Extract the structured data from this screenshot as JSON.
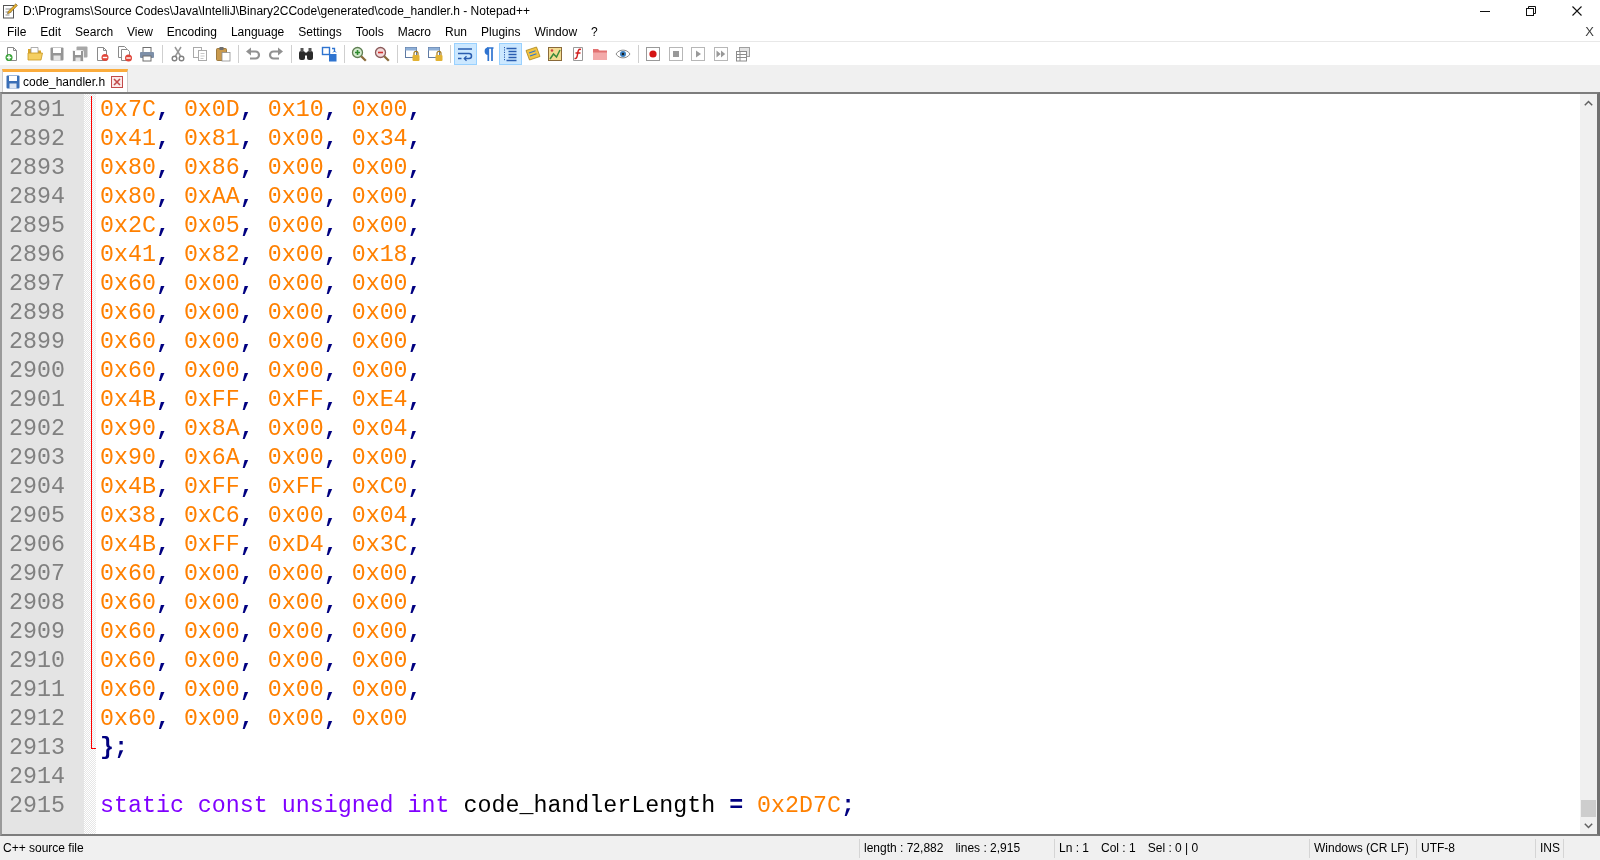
{
  "window": {
    "title": "D:\\Programs\\Source Codes\\Java\\IntelliJ\\Binary2CCode\\generated\\code_handler.h - Notepad++"
  },
  "menu": {
    "items": [
      "File",
      "Edit",
      "Search",
      "View",
      "Encoding",
      "Language",
      "Settings",
      "Tools",
      "Macro",
      "Run",
      "Plugins",
      "Window",
      "?"
    ],
    "close_document": "X"
  },
  "toolbar": {
    "groups": [
      {
        "buttons": [
          {
            "kind": "new",
            "pressed": false,
            "disabled": false
          },
          {
            "kind": "open",
            "pressed": false,
            "disabled": false
          },
          {
            "kind": "save",
            "pressed": false,
            "disabled": true
          },
          {
            "kind": "saveall",
            "pressed": false,
            "disabled": true
          },
          {
            "kind": "close",
            "pressed": false,
            "disabled": false
          },
          {
            "kind": "closeall",
            "pressed": false,
            "disabled": false
          },
          {
            "kind": "print",
            "pressed": false,
            "disabled": false
          }
        ]
      },
      {
        "buttons": [
          {
            "kind": "cut",
            "pressed": false,
            "disabled": true
          },
          {
            "kind": "copy",
            "pressed": false,
            "disabled": true
          },
          {
            "kind": "paste",
            "pressed": false,
            "disabled": false
          }
        ]
      },
      {
        "buttons": [
          {
            "kind": "undo",
            "pressed": false,
            "disabled": true
          },
          {
            "kind": "redo",
            "pressed": false,
            "disabled": true
          }
        ]
      },
      {
        "buttons": [
          {
            "kind": "find",
            "pressed": false,
            "disabled": false
          },
          {
            "kind": "replace",
            "pressed": false,
            "disabled": false
          }
        ]
      },
      {
        "buttons": [
          {
            "kind": "zoomin",
            "pressed": false,
            "disabled": false
          },
          {
            "kind": "zoomout",
            "pressed": false,
            "disabled": false
          }
        ]
      },
      {
        "buttons": [
          {
            "kind": "syncv",
            "pressed": false,
            "disabled": false
          },
          {
            "kind": "synch",
            "pressed": false,
            "disabled": false
          }
        ]
      },
      {
        "buttons": [
          {
            "kind": "wrap",
            "pressed": true,
            "disabled": false
          },
          {
            "kind": "allchars",
            "pressed": false,
            "disabled": false
          },
          {
            "kind": "indent",
            "pressed": true,
            "disabled": false
          },
          {
            "kind": "udl",
            "pressed": false,
            "disabled": false
          },
          {
            "kind": "docmap",
            "pressed": false,
            "disabled": false
          },
          {
            "kind": "funclist",
            "pressed": false,
            "disabled": false
          },
          {
            "kind": "folder",
            "pressed": false,
            "disabled": false
          },
          {
            "kind": "monitor",
            "pressed": false,
            "disabled": false
          }
        ]
      },
      {
        "buttons": [
          {
            "kind": "record",
            "pressed": false,
            "disabled": false
          },
          {
            "kind": "stop",
            "pressed": false,
            "disabled": true
          },
          {
            "kind": "play",
            "pressed": false,
            "disabled": true
          },
          {
            "kind": "playmulti",
            "pressed": false,
            "disabled": true
          },
          {
            "kind": "savemacro",
            "pressed": false,
            "disabled": true
          }
        ]
      }
    ]
  },
  "tabs": [
    {
      "label": "code_handler.h",
      "selected": true,
      "modified": false
    }
  ],
  "editor": {
    "lines": [
      {
        "number": "2891",
        "in_fold": true,
        "fold_end": false,
        "tokens": [
          {
            "kind": "hex",
            "text": "0x7C"
          },
          {
            "kind": "operator",
            "text": ", "
          },
          {
            "kind": "hex",
            "text": "0x0D"
          },
          {
            "kind": "operator",
            "text": ", "
          },
          {
            "kind": "hex",
            "text": "0x10"
          },
          {
            "kind": "operator",
            "text": ", "
          },
          {
            "kind": "hex",
            "text": "0x00"
          },
          {
            "kind": "operator",
            "text": ","
          }
        ]
      },
      {
        "number": "2892",
        "in_fold": true,
        "fold_end": false,
        "tokens": [
          {
            "kind": "hex",
            "text": "0x41"
          },
          {
            "kind": "operator",
            "text": ", "
          },
          {
            "kind": "hex",
            "text": "0x81"
          },
          {
            "kind": "operator",
            "text": ", "
          },
          {
            "kind": "hex",
            "text": "0x00"
          },
          {
            "kind": "operator",
            "text": ", "
          },
          {
            "kind": "hex",
            "text": "0x34"
          },
          {
            "kind": "operator",
            "text": ","
          }
        ]
      },
      {
        "number": "2893",
        "in_fold": true,
        "fold_end": false,
        "tokens": [
          {
            "kind": "hex",
            "text": "0x80"
          },
          {
            "kind": "operator",
            "text": ", "
          },
          {
            "kind": "hex",
            "text": "0x86"
          },
          {
            "kind": "operator",
            "text": ", "
          },
          {
            "kind": "hex",
            "text": "0x00"
          },
          {
            "kind": "operator",
            "text": ", "
          },
          {
            "kind": "hex",
            "text": "0x00"
          },
          {
            "kind": "operator",
            "text": ","
          }
        ]
      },
      {
        "number": "2894",
        "in_fold": true,
        "fold_end": false,
        "tokens": [
          {
            "kind": "hex",
            "text": "0x80"
          },
          {
            "kind": "operator",
            "text": ", "
          },
          {
            "kind": "hex",
            "text": "0xAA"
          },
          {
            "kind": "operator",
            "text": ", "
          },
          {
            "kind": "hex",
            "text": "0x00"
          },
          {
            "kind": "operator",
            "text": ", "
          },
          {
            "kind": "hex",
            "text": "0x00"
          },
          {
            "kind": "operator",
            "text": ","
          }
        ]
      },
      {
        "number": "2895",
        "in_fold": true,
        "fold_end": false,
        "tokens": [
          {
            "kind": "hex",
            "text": "0x2C"
          },
          {
            "kind": "operator",
            "text": ", "
          },
          {
            "kind": "hex",
            "text": "0x05"
          },
          {
            "kind": "operator",
            "text": ", "
          },
          {
            "kind": "hex",
            "text": "0x00"
          },
          {
            "kind": "operator",
            "text": ", "
          },
          {
            "kind": "hex",
            "text": "0x00"
          },
          {
            "kind": "operator",
            "text": ","
          }
        ]
      },
      {
        "number": "2896",
        "in_fold": true,
        "fold_end": false,
        "tokens": [
          {
            "kind": "hex",
            "text": "0x41"
          },
          {
            "kind": "operator",
            "text": ", "
          },
          {
            "kind": "hex",
            "text": "0x82"
          },
          {
            "kind": "operator",
            "text": ", "
          },
          {
            "kind": "hex",
            "text": "0x00"
          },
          {
            "kind": "operator",
            "text": ", "
          },
          {
            "kind": "hex",
            "text": "0x18"
          },
          {
            "kind": "operator",
            "text": ","
          }
        ]
      },
      {
        "number": "2897",
        "in_fold": true,
        "fold_end": false,
        "tokens": [
          {
            "kind": "hex",
            "text": "0x60"
          },
          {
            "kind": "operator",
            "text": ", "
          },
          {
            "kind": "hex",
            "text": "0x00"
          },
          {
            "kind": "operator",
            "text": ", "
          },
          {
            "kind": "hex",
            "text": "0x00"
          },
          {
            "kind": "operator",
            "text": ", "
          },
          {
            "kind": "hex",
            "text": "0x00"
          },
          {
            "kind": "operator",
            "text": ","
          }
        ]
      },
      {
        "number": "2898",
        "in_fold": true,
        "fold_end": false,
        "tokens": [
          {
            "kind": "hex",
            "text": "0x60"
          },
          {
            "kind": "operator",
            "text": ", "
          },
          {
            "kind": "hex",
            "text": "0x00"
          },
          {
            "kind": "operator",
            "text": ", "
          },
          {
            "kind": "hex",
            "text": "0x00"
          },
          {
            "kind": "operator",
            "text": ", "
          },
          {
            "kind": "hex",
            "text": "0x00"
          },
          {
            "kind": "operator",
            "text": ","
          }
        ]
      },
      {
        "number": "2899",
        "in_fold": true,
        "fold_end": false,
        "tokens": [
          {
            "kind": "hex",
            "text": "0x60"
          },
          {
            "kind": "operator",
            "text": ", "
          },
          {
            "kind": "hex",
            "text": "0x00"
          },
          {
            "kind": "operator",
            "text": ", "
          },
          {
            "kind": "hex",
            "text": "0x00"
          },
          {
            "kind": "operator",
            "text": ", "
          },
          {
            "kind": "hex",
            "text": "0x00"
          },
          {
            "kind": "operator",
            "text": ","
          }
        ]
      },
      {
        "number": "2900",
        "in_fold": true,
        "fold_end": false,
        "tokens": [
          {
            "kind": "hex",
            "text": "0x60"
          },
          {
            "kind": "operator",
            "text": ", "
          },
          {
            "kind": "hex",
            "text": "0x00"
          },
          {
            "kind": "operator",
            "text": ", "
          },
          {
            "kind": "hex",
            "text": "0x00"
          },
          {
            "kind": "operator",
            "text": ", "
          },
          {
            "kind": "hex",
            "text": "0x00"
          },
          {
            "kind": "operator",
            "text": ","
          }
        ]
      },
      {
        "number": "2901",
        "in_fold": true,
        "fold_end": false,
        "tokens": [
          {
            "kind": "hex",
            "text": "0x4B"
          },
          {
            "kind": "operator",
            "text": ", "
          },
          {
            "kind": "hex",
            "text": "0xFF"
          },
          {
            "kind": "operator",
            "text": ", "
          },
          {
            "kind": "hex",
            "text": "0xFF"
          },
          {
            "kind": "operator",
            "text": ", "
          },
          {
            "kind": "hex",
            "text": "0xE4"
          },
          {
            "kind": "operator",
            "text": ","
          }
        ]
      },
      {
        "number": "2902",
        "in_fold": true,
        "fold_end": false,
        "tokens": [
          {
            "kind": "hex",
            "text": "0x90"
          },
          {
            "kind": "operator",
            "text": ", "
          },
          {
            "kind": "hex",
            "text": "0x8A"
          },
          {
            "kind": "operator",
            "text": ", "
          },
          {
            "kind": "hex",
            "text": "0x00"
          },
          {
            "kind": "operator",
            "text": ", "
          },
          {
            "kind": "hex",
            "text": "0x04"
          },
          {
            "kind": "operator",
            "text": ","
          }
        ]
      },
      {
        "number": "2903",
        "in_fold": true,
        "fold_end": false,
        "tokens": [
          {
            "kind": "hex",
            "text": "0x90"
          },
          {
            "kind": "operator",
            "text": ", "
          },
          {
            "kind": "hex",
            "text": "0x6A"
          },
          {
            "kind": "operator",
            "text": ", "
          },
          {
            "kind": "hex",
            "text": "0x00"
          },
          {
            "kind": "operator",
            "text": ", "
          },
          {
            "kind": "hex",
            "text": "0x00"
          },
          {
            "kind": "operator",
            "text": ","
          }
        ]
      },
      {
        "number": "2904",
        "in_fold": true,
        "fold_end": false,
        "tokens": [
          {
            "kind": "hex",
            "text": "0x4B"
          },
          {
            "kind": "operator",
            "text": ", "
          },
          {
            "kind": "hex",
            "text": "0xFF"
          },
          {
            "kind": "operator",
            "text": ", "
          },
          {
            "kind": "hex",
            "text": "0xFF"
          },
          {
            "kind": "operator",
            "text": ", "
          },
          {
            "kind": "hex",
            "text": "0xC0"
          },
          {
            "kind": "operator",
            "text": ","
          }
        ]
      },
      {
        "number": "2905",
        "in_fold": true,
        "fold_end": false,
        "tokens": [
          {
            "kind": "hex",
            "text": "0x38"
          },
          {
            "kind": "operator",
            "text": ", "
          },
          {
            "kind": "hex",
            "text": "0xC6"
          },
          {
            "kind": "operator",
            "text": ", "
          },
          {
            "kind": "hex",
            "text": "0x00"
          },
          {
            "kind": "operator",
            "text": ", "
          },
          {
            "kind": "hex",
            "text": "0x04"
          },
          {
            "kind": "operator",
            "text": ","
          }
        ]
      },
      {
        "number": "2906",
        "in_fold": true,
        "fold_end": false,
        "tokens": [
          {
            "kind": "hex",
            "text": "0x4B"
          },
          {
            "kind": "operator",
            "text": ", "
          },
          {
            "kind": "hex",
            "text": "0xFF"
          },
          {
            "kind": "operator",
            "text": ", "
          },
          {
            "kind": "hex",
            "text": "0xD4"
          },
          {
            "kind": "operator",
            "text": ", "
          },
          {
            "kind": "hex",
            "text": "0x3C"
          },
          {
            "kind": "operator",
            "text": ","
          }
        ]
      },
      {
        "number": "2907",
        "in_fold": true,
        "fold_end": false,
        "tokens": [
          {
            "kind": "hex",
            "text": "0x60"
          },
          {
            "kind": "operator",
            "text": ", "
          },
          {
            "kind": "hex",
            "text": "0x00"
          },
          {
            "kind": "operator",
            "text": ", "
          },
          {
            "kind": "hex",
            "text": "0x00"
          },
          {
            "kind": "operator",
            "text": ", "
          },
          {
            "kind": "hex",
            "text": "0x00"
          },
          {
            "kind": "operator",
            "text": ","
          }
        ]
      },
      {
        "number": "2908",
        "in_fold": true,
        "fold_end": false,
        "tokens": [
          {
            "kind": "hex",
            "text": "0x60"
          },
          {
            "kind": "operator",
            "text": ", "
          },
          {
            "kind": "hex",
            "text": "0x00"
          },
          {
            "kind": "operator",
            "text": ", "
          },
          {
            "kind": "hex",
            "text": "0x00"
          },
          {
            "kind": "operator",
            "text": ", "
          },
          {
            "kind": "hex",
            "text": "0x00"
          },
          {
            "kind": "operator",
            "text": ","
          }
        ]
      },
      {
        "number": "2909",
        "in_fold": true,
        "fold_end": false,
        "tokens": [
          {
            "kind": "hex",
            "text": "0x60"
          },
          {
            "kind": "operator",
            "text": ", "
          },
          {
            "kind": "hex",
            "text": "0x00"
          },
          {
            "kind": "operator",
            "text": ", "
          },
          {
            "kind": "hex",
            "text": "0x00"
          },
          {
            "kind": "operator",
            "text": ", "
          },
          {
            "kind": "hex",
            "text": "0x00"
          },
          {
            "kind": "operator",
            "text": ","
          }
        ]
      },
      {
        "number": "2910",
        "in_fold": true,
        "fold_end": false,
        "tokens": [
          {
            "kind": "hex",
            "text": "0x60"
          },
          {
            "kind": "operator",
            "text": ", "
          },
          {
            "kind": "hex",
            "text": "0x00"
          },
          {
            "kind": "operator",
            "text": ", "
          },
          {
            "kind": "hex",
            "text": "0x00"
          },
          {
            "kind": "operator",
            "text": ", "
          },
          {
            "kind": "hex",
            "text": "0x00"
          },
          {
            "kind": "operator",
            "text": ","
          }
        ]
      },
      {
        "number": "2911",
        "in_fold": true,
        "fold_end": false,
        "tokens": [
          {
            "kind": "hex",
            "text": "0x60"
          },
          {
            "kind": "operator",
            "text": ", "
          },
          {
            "kind": "hex",
            "text": "0x00"
          },
          {
            "kind": "operator",
            "text": ", "
          },
          {
            "kind": "hex",
            "text": "0x00"
          },
          {
            "kind": "operator",
            "text": ", "
          },
          {
            "kind": "hex",
            "text": "0x00"
          },
          {
            "kind": "operator",
            "text": ","
          }
        ]
      },
      {
        "number": "2912",
        "in_fold": true,
        "fold_end": false,
        "tokens": [
          {
            "kind": "hex",
            "text": "0x60"
          },
          {
            "kind": "operator",
            "text": ", "
          },
          {
            "kind": "hex",
            "text": "0x00"
          },
          {
            "kind": "operator",
            "text": ", "
          },
          {
            "kind": "hex",
            "text": "0x00"
          },
          {
            "kind": "operator",
            "text": ", "
          },
          {
            "kind": "hex",
            "text": "0x00"
          }
        ]
      },
      {
        "number": "2913",
        "in_fold": false,
        "fold_end": true,
        "tokens": [
          {
            "kind": "operator",
            "text": "};"
          }
        ]
      },
      {
        "number": "2914",
        "in_fold": false,
        "fold_end": false
      },
      {
        "number": "2915",
        "in_fold": false,
        "fold_end": false,
        "tokens": [
          {
            "kind": "keyword",
            "text": "static const unsigned int"
          },
          {
            "kind": "plain",
            "text": " code_handlerLength "
          },
          {
            "kind": "operator",
            "text": "="
          },
          {
            "kind": "hex",
            "text": " 0x2D7C"
          },
          {
            "kind": "operator",
            "text": ";"
          }
        ]
      }
    ]
  },
  "status_bar": {
    "sections": [
      {
        "texts": [
          "C++ source file"
        ]
      },
      {
        "texts": [
          "length : 72,882",
          "lines : 2,915"
        ]
      },
      {
        "texts": [
          "Ln : 1",
          "Col : 1",
          "Sel : 0 | 0"
        ]
      },
      {
        "texts": [
          "Windows (CR LF)"
        ]
      },
      {
        "texts": [
          "UTF-8"
        ]
      },
      {
        "texts": [
          "INS"
        ]
      }
    ]
  }
}
